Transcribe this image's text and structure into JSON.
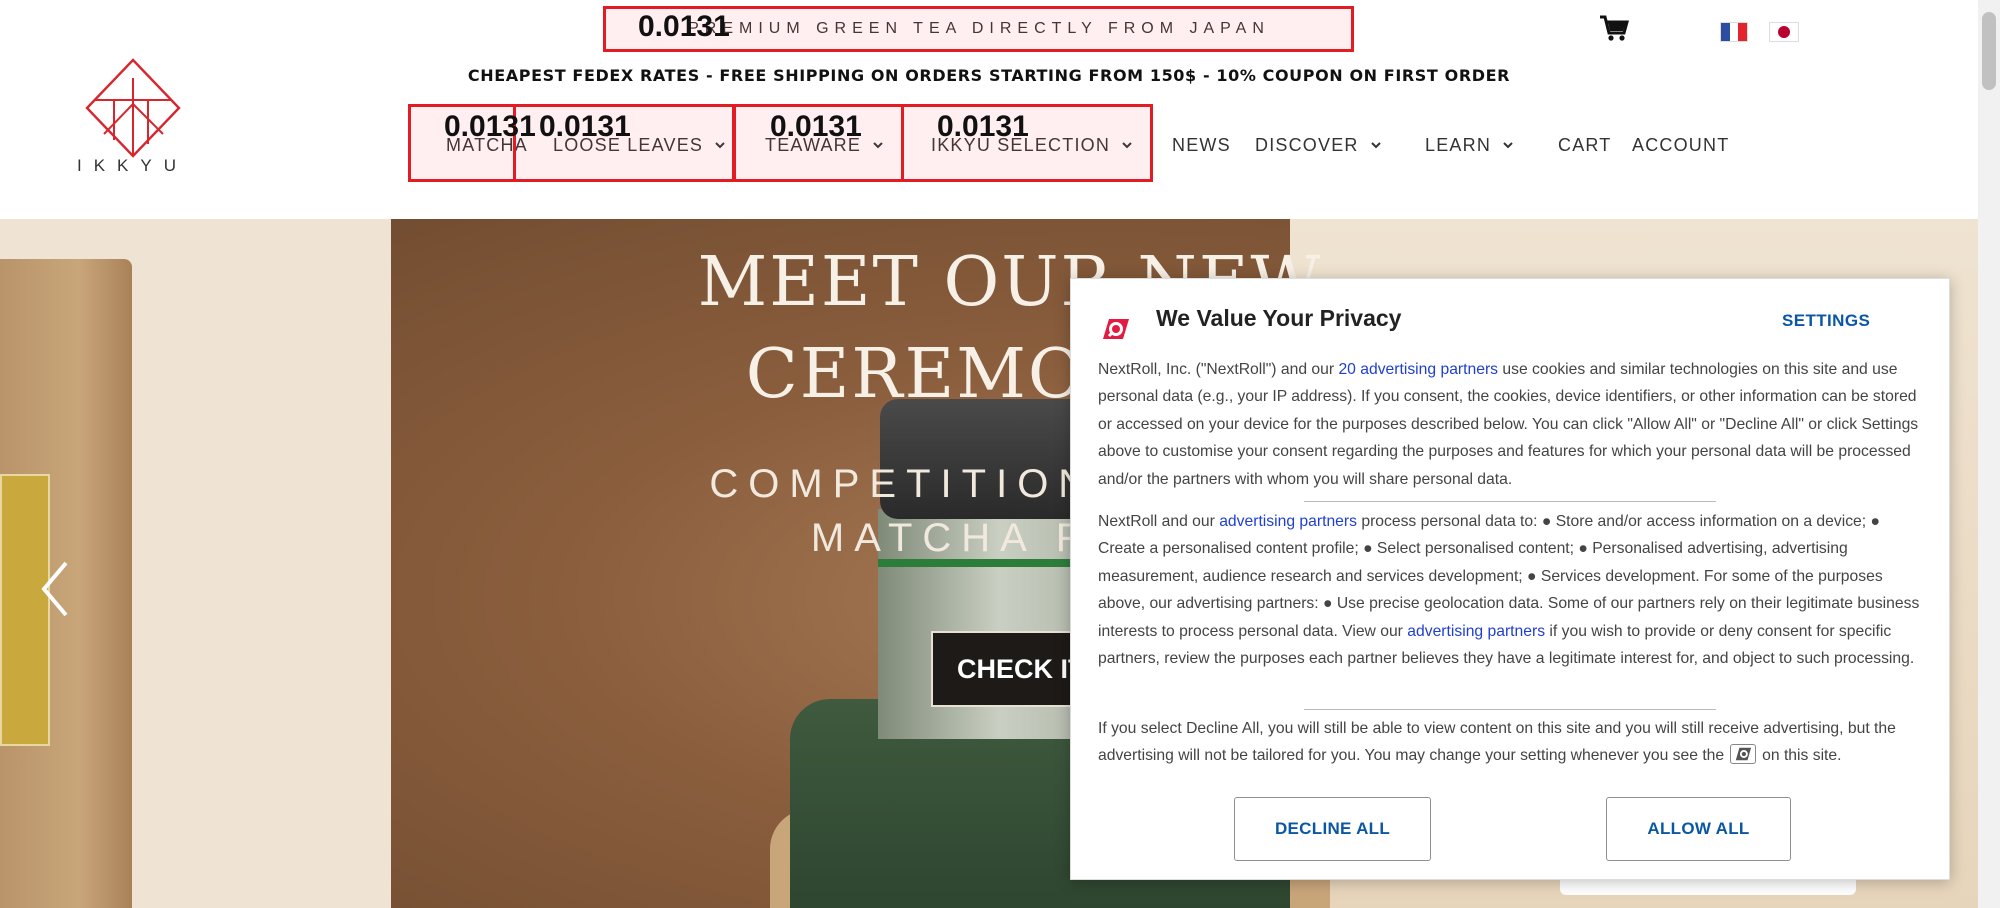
{
  "header": {
    "topline": "PREMIUM GREEN TEA DIRECTLY FROM JAPAN",
    "shipping_banner": "CHEAPEST FEDEX RATES - FREE SHIPPING ON ORDERS STARTING FROM 150$ - 10% COUPON ON FIRST ORDER",
    "logo_text": "IKKYU",
    "nav": [
      {
        "label": "MATCHA"
      },
      {
        "label": "LOOSE LEAVES"
      },
      {
        "label": "TEAWARE"
      },
      {
        "label": "IKKYU SELECTION"
      },
      {
        "label": "NEWS"
      },
      {
        "label": "DISCOVER"
      },
      {
        "label": "LEARN"
      },
      {
        "label": "CART"
      },
      {
        "label": "ACCOUNT"
      }
    ]
  },
  "overlays": {
    "labels": [
      "0.0131",
      "0.0131",
      "0.0131",
      "0.0131",
      "0.0131"
    ],
    "color": "#e31b23"
  },
  "hero": {
    "title_line1": "MEET OUR NEW",
    "title_line2": "CEREMONIAL",
    "subtitle_line1": "COMPETITION AND",
    "subtitle_line2": "MATCHA FR",
    "cta": "CHECK IT"
  },
  "consent": {
    "title": "We Value Your Privacy",
    "settings": "SETTINGS",
    "p1_pre": "NextRoll, Inc. (\"NextRoll\") and our ",
    "p1_link": "20 advertising partners",
    "p1_post": " use cookies and similar technologies on this site and use personal data (e.g., your IP address). If you consent, the cookies, device identifiers, or other information can be stored or accessed on your device for the purposes described below. You can click \"Allow All\" or \"Decline All\" or click Settings above to customise your consent regarding the purposes and features for which your personal data will be processed and/or the partners with whom you will share personal data.",
    "p2_pre": "NextRoll and our ",
    "p2_link1": "advertising partners",
    "p2_mid": " process personal data to: ● Store and/or access information on a device; ● Create a personalised content profile; ● Select personalised content; ● Personalised advertising, advertising measurement, audience research and services development; ● Services development. For some of the purposes above, our advertising partners: ● Use precise geolocation data. Some of our partners rely on their legitimate business interests to process personal data. View our ",
    "p2_link2": "advertising partners",
    "p2_post": " if you wish to provide or deny consent for specific partners, review the purposes each partner believes they have a legitimate interest for, and object to such processing.",
    "p3_pre": "If you select Decline All, you will still be able to view content on this site and you will still receive advertising, but the advertising will not be tailored for you. You may change your setting whenever you see the",
    "p3_post": "on this site.",
    "decline": "DECLINE ALL",
    "allow": "ALLOW ALL"
  },
  "colors": {
    "accent_red": "#e31b23",
    "consent_blue": "#0b57a4",
    "link_blue": "#1f3fd1",
    "logo_red": "#d7262e"
  },
  "icons": [
    "cart-icon",
    "flag-france-icon",
    "flag-japan-icon",
    "chevron-down-icon",
    "chevron-left-icon",
    "nextroll-icon"
  ]
}
